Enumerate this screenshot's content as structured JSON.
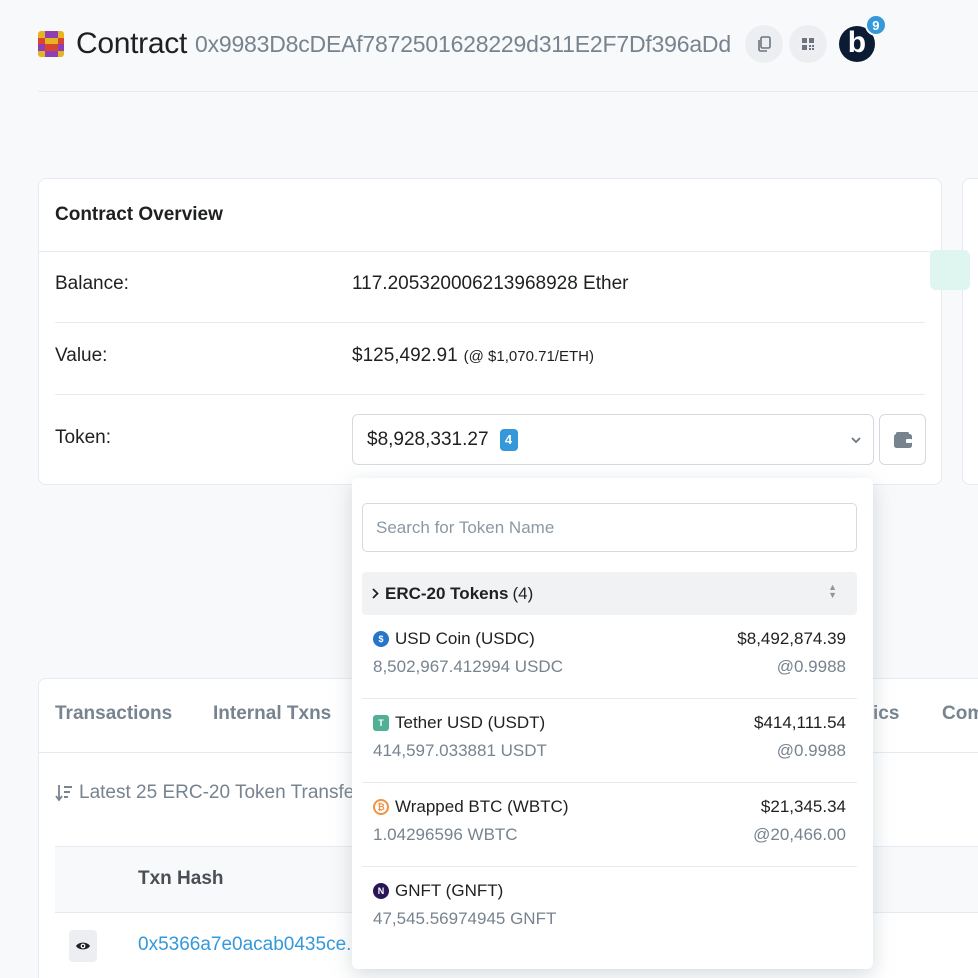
{
  "header": {
    "title": "Contract",
    "address": "0x9983D8cDEAf7872501628229d311E2F7Df396aDd",
    "copy_icon": "copy-icon",
    "qr_icon": "qr-code-icon",
    "blockscan_letter": "b",
    "blockscan_badge": "9"
  },
  "overview": {
    "title": "Contract Overview",
    "balance_label": "Balance:",
    "balance_value": "117.205320006213968928 Ether",
    "value_label": "Value:",
    "value_amount": "$125,492.91",
    "value_rate": "(@ $1,070.71/ETH)",
    "token_label": "Token:",
    "token_total": "$8,928,331.27",
    "token_count": "4"
  },
  "tabs": {
    "items": [
      {
        "label": "Transactions"
      },
      {
        "label": "Internal Txns"
      },
      {
        "label": "ics"
      },
      {
        "label": "Com"
      }
    ],
    "latest_text": "Latest 25 ERC-20 Token Transfer",
    "column_txn_hash": "Txn Hash",
    "row_hash": "0x5366a7e0acab0435ce..."
  },
  "dropdown": {
    "search_placeholder": "Search for Token Name",
    "group_label": "ERC-20 Tokens",
    "group_count": "(4)",
    "tokens": [
      {
        "name": "USD Coin (USDC)",
        "quantity": "8,502,967.412994 USDC",
        "value": "$8,492,874.39",
        "rate": "@0.9988",
        "icon": "usdc-icon",
        "color": "#2775ca"
      },
      {
        "name": "Tether USD (USDT)",
        "quantity": "414,597.033881 USDT",
        "value": "$414,111.54",
        "rate": "@0.9988",
        "icon": "usdt-icon",
        "color": "#50af95"
      },
      {
        "name": "Wrapped BTC (WBTC)",
        "quantity": "1.04296596 WBTC",
        "value": "$21,345.34",
        "rate": "@20,466.00",
        "icon": "wbtc-icon",
        "color": "#f09242"
      },
      {
        "name": "GNFT (GNFT)",
        "quantity": "47,545.56974945 GNFT",
        "value": "",
        "rate": "",
        "icon": "gnft-icon",
        "color": "#2a1657"
      }
    ]
  },
  "colors": {
    "accent": "#3498db",
    "text_primary": "#1e2022",
    "text_muted": "#77838f"
  }
}
